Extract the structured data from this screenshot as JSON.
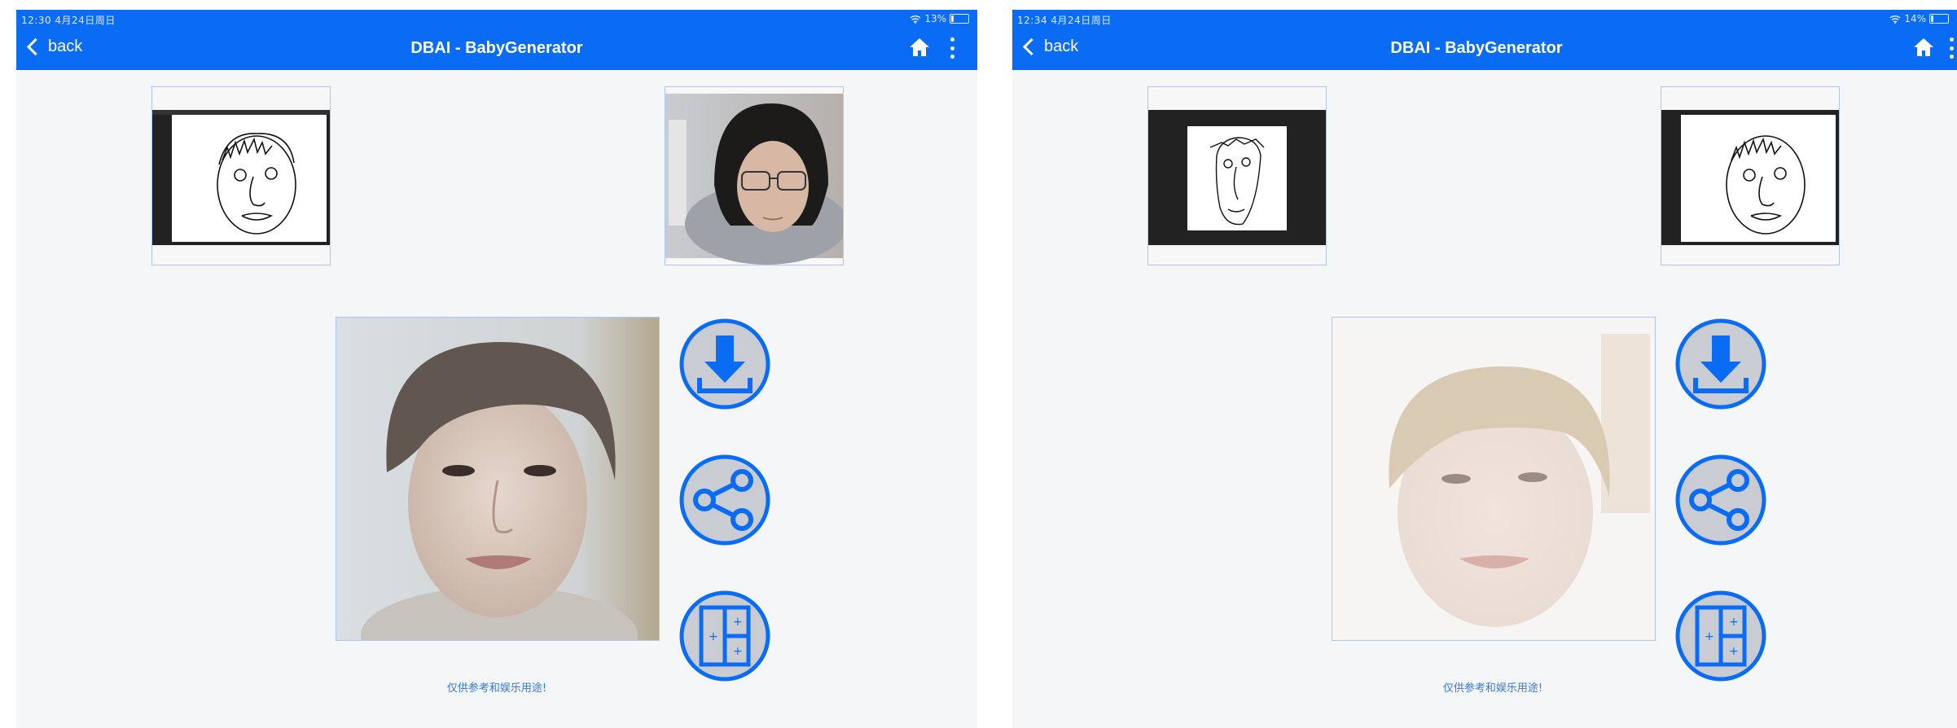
{
  "screens": [
    {
      "status_time": "12:30  4月24日周日",
      "battery": "13%",
      "back_label": "back",
      "title": "DBAI - BabyGenerator",
      "disclaimer": "仅供参考和娱乐用途!",
      "icons": {
        "home": "home-icon",
        "more": "more-vertical-icon",
        "download": "download-icon",
        "share": "share-icon",
        "layout": "grid-layout-icon",
        "wifi": "wifi-icon",
        "battery": "battery-icon"
      }
    },
    {
      "status_time": "12:34  4月24日周日",
      "battery": "14%",
      "back_label": "back",
      "title": "DBAI - BabyGenerator",
      "disclaimer": "仅供参考和娱乐用途!",
      "icons": {
        "home": "home-icon",
        "more": "more-vertical-icon",
        "download": "download-icon",
        "share": "share-icon",
        "layout": "grid-layout-icon",
        "wifi": "wifi-icon",
        "battery": "battery-icon"
      }
    }
  ],
  "colors": {
    "navbar": "#0a6cf5",
    "button_ring": "#0a6cf5",
    "button_fill": "#c9cdd3",
    "disclaimer": "#3a78d8"
  },
  "battery_levels": [
    0.13,
    0.14
  ]
}
